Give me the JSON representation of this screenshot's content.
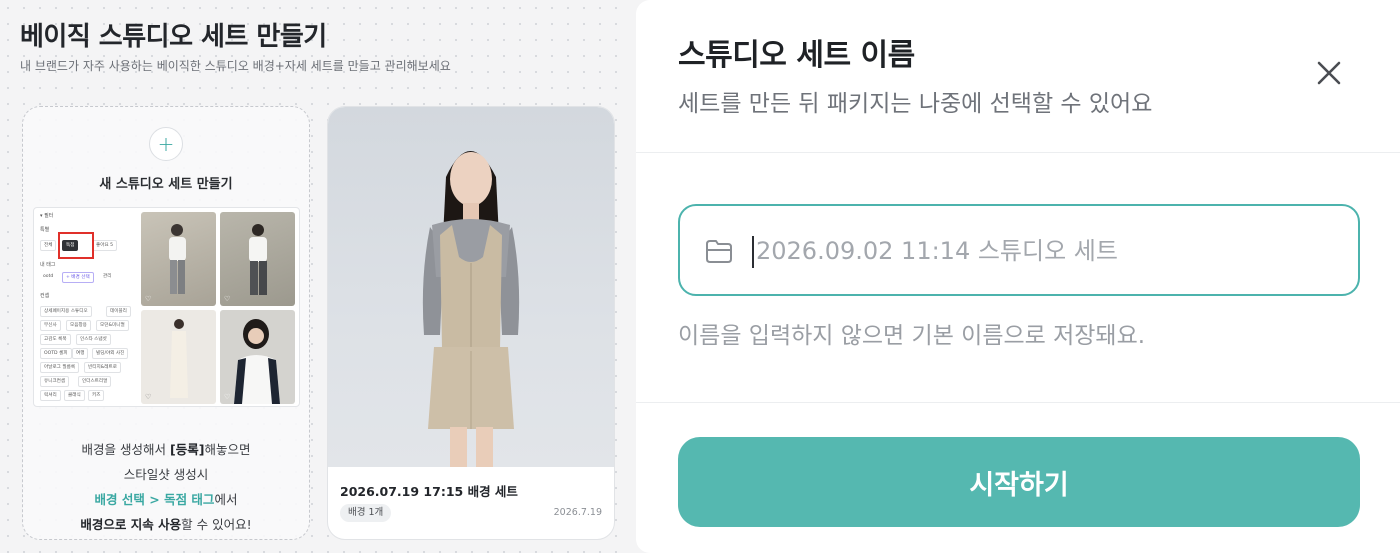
{
  "page": {
    "title": "베이직 스튜디오 세트 만들기",
    "subtitle": "내 브랜드가 자주 사용하는 베이직한 스튜디오 배경+자세 세트를 만들고 관리해보세요"
  },
  "new_card": {
    "plus_symbol": "+",
    "title": "새 스튜디오 세트 만들기",
    "desc_line1": "배경을 생성해서 ",
    "desc_register": "[등록]",
    "desc_line1_tail": "해놓으면",
    "desc_line2": "스타일샷 생성시",
    "desc_line3_teal": "배경 선택 > 독점 태그",
    "desc_line3_tail": "에서",
    "desc_line4_bold": "배경으로 지속 사용",
    "desc_line4_tail": "할 수 있어요!",
    "preview": {
      "filter_label": "필터",
      "special_label": "특별",
      "chip_all": "전체",
      "chip_exclusive": "독점",
      "chip_like": "좋아요 5",
      "my_tags_label": "내 태그",
      "chip_ootd": "ootd",
      "chip_bg_select": "+ 배경 선택",
      "chip_manage": "관리",
      "concept_label": "컨셉",
      "tags": [
        "상세페이지용 스튜디오",
        "데이블리",
        "무신사",
        "모음창용",
        "모던&미니멀",
        "고감도 룩북",
        "인스타 스냅샷",
        "OOTD 셀피",
        "여행",
        "빌딩/야외 사진",
        "아날로그 필름룩",
        "빈티지&레트로",
        "유니크컨셉",
        "인더스트리얼",
        "럭셔리",
        "클래식",
        "키즈"
      ]
    }
  },
  "set_card": {
    "title": "2026.07.19 17:15 배경 세트",
    "badge": "배경 1개",
    "date": "2026.7.19"
  },
  "modal": {
    "title": "스튜디오 세트 이름",
    "subtitle": "세트를 만든 뒤 패키지는 나중에 선택할 수 있어요",
    "input_placeholder": "2026.09.02 11:14 스튜디오 세트",
    "input_value": "",
    "hint": "이름을 입력하지 않으면 기본 이름으로 저장돼요.",
    "start_button": "시작하기"
  },
  "colors": {
    "accent": "#55b8b0",
    "accent_border": "#4cb3ad",
    "highlight_red": "#e0302a"
  },
  "icons": {
    "close": "close-icon",
    "folder": "folder-icon",
    "plus": "plus-icon",
    "heart": "heart-icon"
  }
}
